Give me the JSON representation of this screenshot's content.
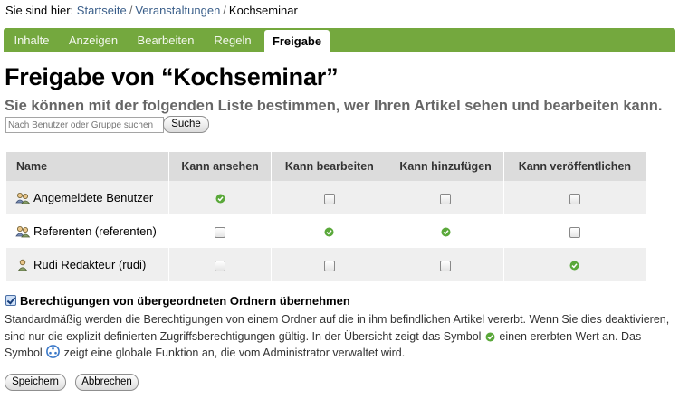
{
  "breadcrumb": {
    "prefix": "Sie sind hier:",
    "items": [
      "Startseite",
      "Veranstaltungen",
      "Kochseminar"
    ]
  },
  "tabs": [
    "Inhalte",
    "Anzeigen",
    "Bearbeiten",
    "Regeln",
    "Freigabe"
  ],
  "active_tab": "Freigabe",
  "page": {
    "title": "Freigabe von “Kochseminar”",
    "subtitle": "Sie können mit der folgenden Liste bestimmen, wer Ihren Artikel sehen und bearbeiten kann."
  },
  "search": {
    "placeholder": "Nach Benutzer oder Gruppe suchen",
    "button": "Suche"
  },
  "table": {
    "headers": [
      "Name",
      "Kann ansehen",
      "Kann bearbeiten",
      "Kann hinzufügen",
      "Kann veröffentlichen"
    ],
    "rows": [
      {
        "name": "Angemeldete Benutzer",
        "icon": "group-icon",
        "perms": [
          "granted",
          "unchecked",
          "unchecked",
          "unchecked"
        ]
      },
      {
        "name": "Referenten (referenten)",
        "icon": "group-icon",
        "perms": [
          "unchecked",
          "granted",
          "granted",
          "unchecked"
        ]
      },
      {
        "name": "Rudi Redakteur (rudi)",
        "icon": "user-icon",
        "perms": [
          "unchecked",
          "unchecked",
          "unchecked",
          "granted"
        ]
      }
    ]
  },
  "inherit": {
    "label": "Berechtigungen von übergeordneten Ordnern übernehmen",
    "checked": true
  },
  "help": {
    "part1": "Standardmäßig werden die Berechtigungen von einem Ordner auf die in ihm befindlichen Artikel vererbt. Wenn Sie dies deaktivieren, sind nur die explizit definierten Zugriffsberechtigungen gültig. In der Übersicht zeigt das Symbol",
    "part2": "einen ererbten Wert an. Das Symbol",
    "part3": "zeigt eine globale Funktion an, die vom Administrator verwaltet wird."
  },
  "buttons": {
    "save": "Speichern",
    "cancel": "Abbrechen"
  },
  "colors": {
    "tabbar": "#74a83e",
    "link": "#3b5f8a",
    "granted": "#5aa83a",
    "table_header": "#dcdcdc"
  }
}
